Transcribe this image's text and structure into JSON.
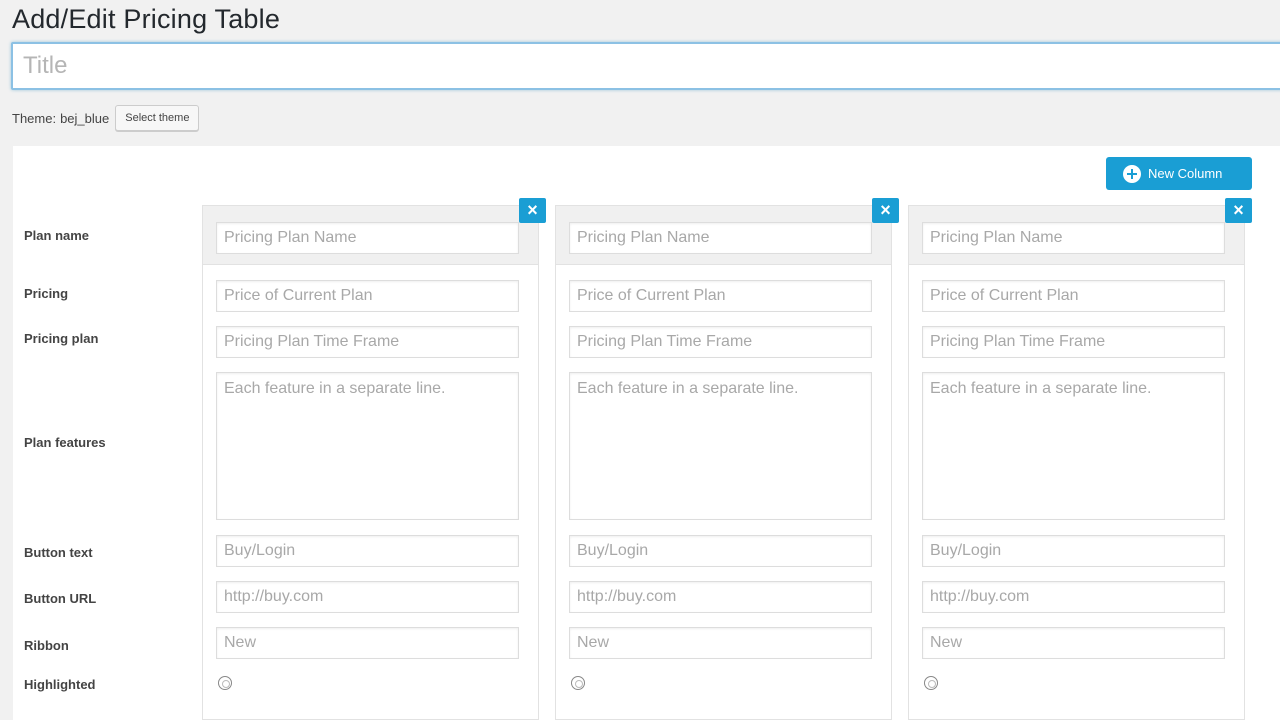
{
  "page": {
    "title": "Add/Edit Pricing Table"
  },
  "title_field": {
    "placeholder": "Title",
    "value": ""
  },
  "theme": {
    "label": "Theme:",
    "value": "bej_blue",
    "button_label": "Select theme"
  },
  "toolbar": {
    "new_column_label": "New Column"
  },
  "row_labels": {
    "plan_name": "Plan name",
    "pricing": "Pricing",
    "pricing_plan": "Pricing plan",
    "plan_features": "Plan features",
    "button_text": "Button text",
    "button_url": "Button URL",
    "ribbon": "Ribbon",
    "highlighted": "Highlighted"
  },
  "columns": [
    {
      "close_label": "×",
      "plan_name_placeholder": "Pricing Plan Name",
      "price_placeholder": "Price of Current Plan",
      "time_frame_placeholder": "Pricing Plan Time Frame",
      "features_placeholder": "Each feature in a separate line.",
      "button_text_placeholder": "Buy/Login",
      "button_url_placeholder": "http://buy.com",
      "ribbon_placeholder": "New",
      "highlighted": false
    },
    {
      "close_label": "×",
      "plan_name_placeholder": "Pricing Plan Name",
      "price_placeholder": "Price of Current Plan",
      "time_frame_placeholder": "Pricing Plan Time Frame",
      "features_placeholder": "Each feature in a separate line.",
      "button_text_placeholder": "Buy/Login",
      "button_url_placeholder": "http://buy.com",
      "ribbon_placeholder": "New",
      "highlighted": false
    },
    {
      "close_label": "×",
      "plan_name_placeholder": "Pricing Plan Name",
      "price_placeholder": "Price of Current Plan",
      "time_frame_placeholder": "Pricing Plan Time Frame",
      "features_placeholder": "Each feature in a separate line.",
      "button_text_placeholder": "Buy/Login",
      "button_url_placeholder": "http://buy.com",
      "ribbon_placeholder": "New",
      "highlighted": false
    }
  ],
  "colors": {
    "accent": "#1a9ed4",
    "focus_border": "#8cc1e4",
    "background": "#f1f1f1"
  },
  "icons": {
    "new_column": "plus-circle-icon",
    "remove_column": "close-icon"
  }
}
